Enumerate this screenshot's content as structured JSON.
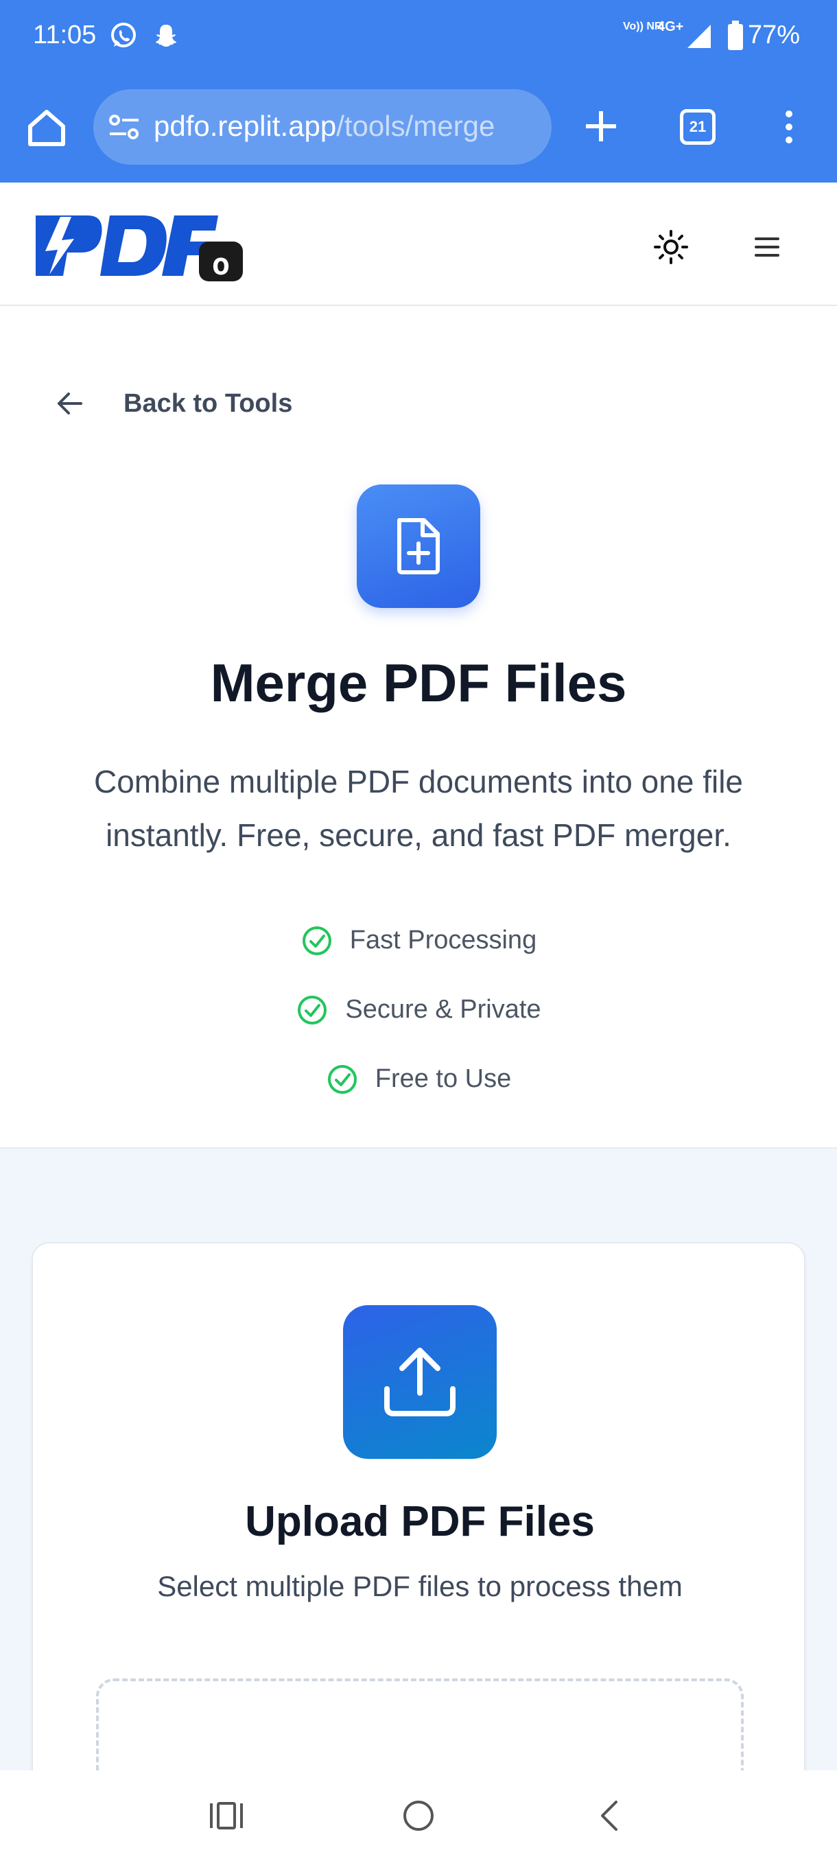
{
  "status_bar": {
    "time": "11:05",
    "network_type": "Vo)) NR",
    "signal": "4G+",
    "battery": "77%"
  },
  "browser": {
    "url_host": "pdfo.replit.app",
    "url_path": "/tools/merge",
    "tab_count": "21"
  },
  "site": {
    "logo_text": "PDFo",
    "brand_color": "#1554d3"
  },
  "hero": {
    "back_label": "Back to Tools",
    "title": "Merge PDF Files",
    "subtitle": "Combine multiple PDF documents into one file instantly. Free, secure, and fast PDF merger.",
    "features": [
      "Fast Processing",
      "Secure & Private",
      "Free to Use"
    ],
    "feature_check_color": "#22c55e"
  },
  "upload": {
    "title": "Upload PDF Files",
    "subtitle": "Select multiple PDF files to process them"
  },
  "icons": {
    "home": "home-icon",
    "site_settings": "tune-icon",
    "new_tab": "plus-icon",
    "tabs": "tab-switcher-icon",
    "menu": "more-vert-icon",
    "theme": "sun-icon",
    "hamburger": "hamburger-icon",
    "back": "arrow-left-icon",
    "tool": "file-plus-icon",
    "upload": "upload-icon",
    "recents": "recents-icon",
    "home_nav": "home-circle-icon",
    "back_nav": "chevron-left-icon"
  }
}
